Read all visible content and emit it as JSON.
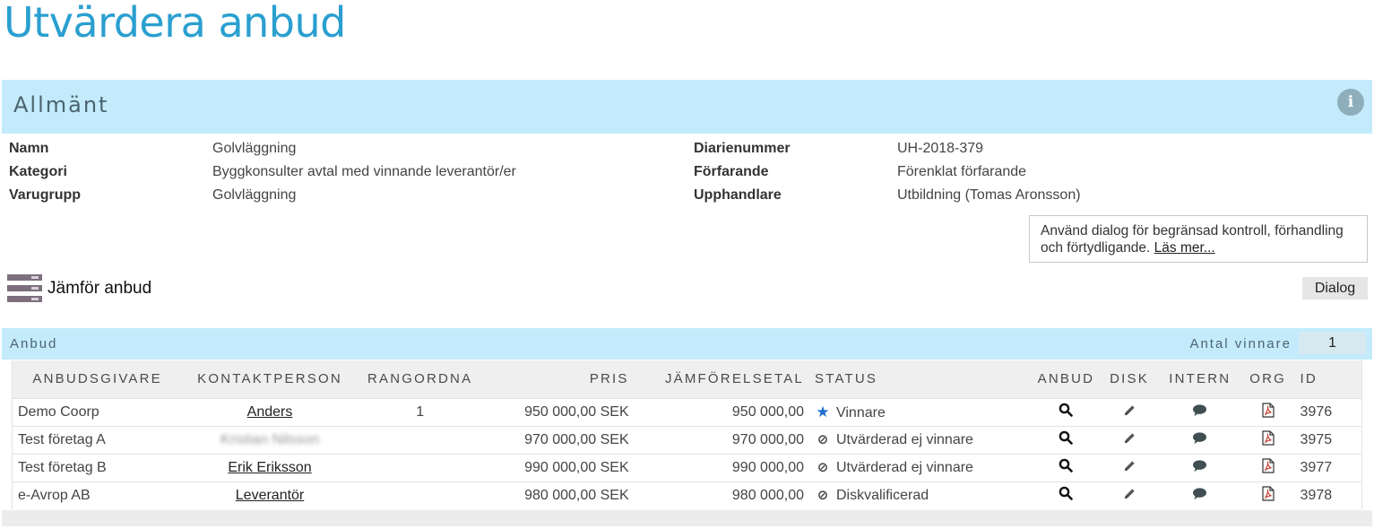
{
  "page": {
    "title": "Utvärdera anbud"
  },
  "general": {
    "title": "Allmänt",
    "info_icon": "info-icon",
    "fields_left": [
      {
        "label": "Namn",
        "value": "Golvläggning"
      },
      {
        "label": "Kategori",
        "value": "Byggkonsulter avtal med vinnande leverantör/er"
      },
      {
        "label": "Varugrupp",
        "value": "Golvläggning"
      }
    ],
    "fields_right": [
      {
        "label": "Diarienummer",
        "value": "UH-2018-379"
      },
      {
        "label": "Förfarande",
        "value": "Förenklat förfarande"
      },
      {
        "label": "Upphandlare",
        "value": "Utbildning (Tomas Aronsson)"
      }
    ]
  },
  "dialog_notice": {
    "text": "Använd dialog för begränsad kontroll, förhandling och förtydligande.",
    "link": "Läs mer..."
  },
  "compare": {
    "title": "Jämför anbud",
    "dialog_button": "Dialog"
  },
  "bids": {
    "title": "Anbud",
    "winners_label": "Antal vinnare",
    "winners_value": "1",
    "columns": [
      "ANBUDSGIVARE",
      "KONTAKTPERSON",
      "RANGORDNA",
      "PRIS",
      "JÄMFÖRELSETAL",
      "STATUS",
      "ANBUD",
      "DISK",
      "INTERN",
      "ORG",
      "ID"
    ],
    "rows": [
      {
        "bidder": "Demo Coorp",
        "contact": "Anders",
        "contact_blurred": false,
        "rank": "1",
        "price": "950 000,00 SEK",
        "comparison": "950 000,00",
        "status": "Vinnare",
        "status_icon": "star-icon",
        "id": "3976"
      },
      {
        "bidder": "Test företag A",
        "contact": "Kristian Nilsson",
        "contact_blurred": true,
        "rank": "",
        "price": "970 000,00 SEK",
        "comparison": "970 000,00",
        "status": "Utvärderad ej vinnare",
        "status_icon": "ban-icon",
        "id": "3975"
      },
      {
        "bidder": "Test företag B",
        "contact": "Erik Eriksson",
        "contact_blurred": false,
        "rank": "",
        "price": "990 000,00 SEK",
        "comparison": "990 000,00",
        "status": "Utvärderad ej vinnare",
        "status_icon": "ban-icon",
        "id": "3977"
      },
      {
        "bidder": "e-Avrop AB",
        "contact": "Leverantör",
        "contact_blurred": false,
        "rank": "",
        "price": "980 000,00 SEK",
        "comparison": "980 000,00",
        "status": "Diskvalificerad",
        "status_icon": "ban-icon",
        "id": "3978"
      }
    ]
  },
  "colors": {
    "title": "#2a9fd0",
    "section_band": "#c3ebfb",
    "winner_star": "#1f6fcf",
    "pdf_icon": "#c0392b"
  }
}
